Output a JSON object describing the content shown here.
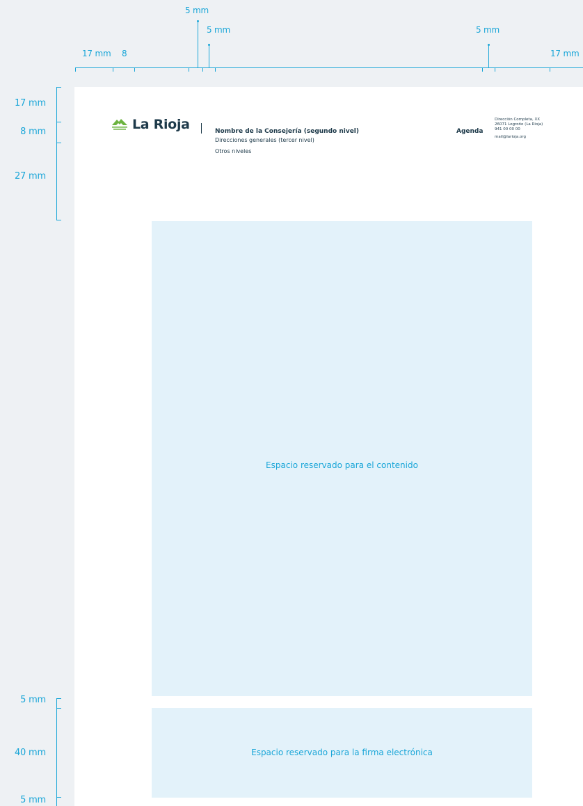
{
  "top_dimensions": {
    "top_5mm": "5 mm",
    "left_5mm": "5 mm",
    "right_5mm": "5 mm",
    "left_17mm": "17 mm",
    "left_8": "8",
    "right_17mm": "17 mm"
  },
  "left_dimensions": {
    "d17": "17 mm",
    "d8": "8 mm",
    "d27": "27 mm",
    "d5a": "5 mm",
    "d40": "40 mm",
    "d5b": "5 mm"
  },
  "header": {
    "logo_text": "La Rioja",
    "consejeria": "Nombre de la Consejería (segundo nivel)",
    "direcciones": "Direcciones generales (tercer nivel)",
    "otros": "Otros niveles",
    "agenda": "Agenda",
    "address_line1": "Dirección Completa, XX",
    "address_line2": "26071 Logroño (La Rioja)",
    "phone": "941 00 00 00",
    "email": "mail@larioja.org"
  },
  "content": {
    "main_label": "Espacio reservado para el contenido",
    "signature_label": "Espacio reservado para la firma electrónica"
  },
  "colors": {
    "accent": "#1aa6d8",
    "page_bg": "#eef1f4",
    "box_fill": "#e3f2fa",
    "logo_green": "#6cb33f",
    "text_dark": "#1e3a4a"
  }
}
